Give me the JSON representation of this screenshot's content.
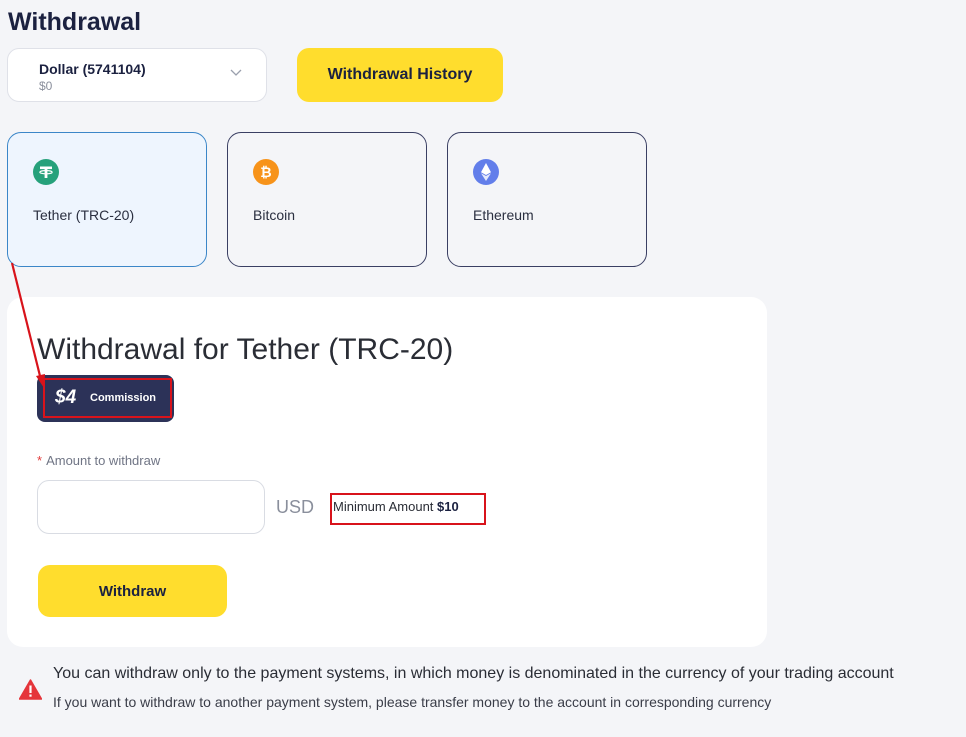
{
  "page": {
    "title": "Withdrawal"
  },
  "account": {
    "name": "Dollar (5741104)",
    "balance": "$0"
  },
  "toolbar": {
    "history_label": "Withdrawal History"
  },
  "methods": [
    {
      "label": "Tether (TRC-20)",
      "icon": "tether-icon",
      "color": "#26a17b",
      "selected": true
    },
    {
      "label": "Bitcoin",
      "icon": "bitcoin-icon",
      "color": "#f7931a",
      "selected": false
    },
    {
      "label": "Ethereum",
      "icon": "ethereum-icon",
      "color": "#627eea",
      "selected": false
    }
  ],
  "panel": {
    "title": "Withdrawal for Tether (TRC-20)",
    "commission_amount": "$4",
    "commission_label": "Commission",
    "amount_label": "Amount to withdraw",
    "amount_value": "",
    "currency": "USD",
    "min_amount_label": "Minimum Amount",
    "min_amount_value": "$10",
    "withdraw_label": "Withdraw"
  },
  "notice": {
    "main": "You can withdraw only to the payment systems, in which money is denominated in the currency of your trading account",
    "sub": "If you want to withdraw to another payment system, please transfer money to the account in corresponding currency"
  },
  "colors": {
    "accent": "#ffdd2d",
    "badge": "#2c3258",
    "annotation": "#d8131b",
    "warning": "#e5353b"
  }
}
